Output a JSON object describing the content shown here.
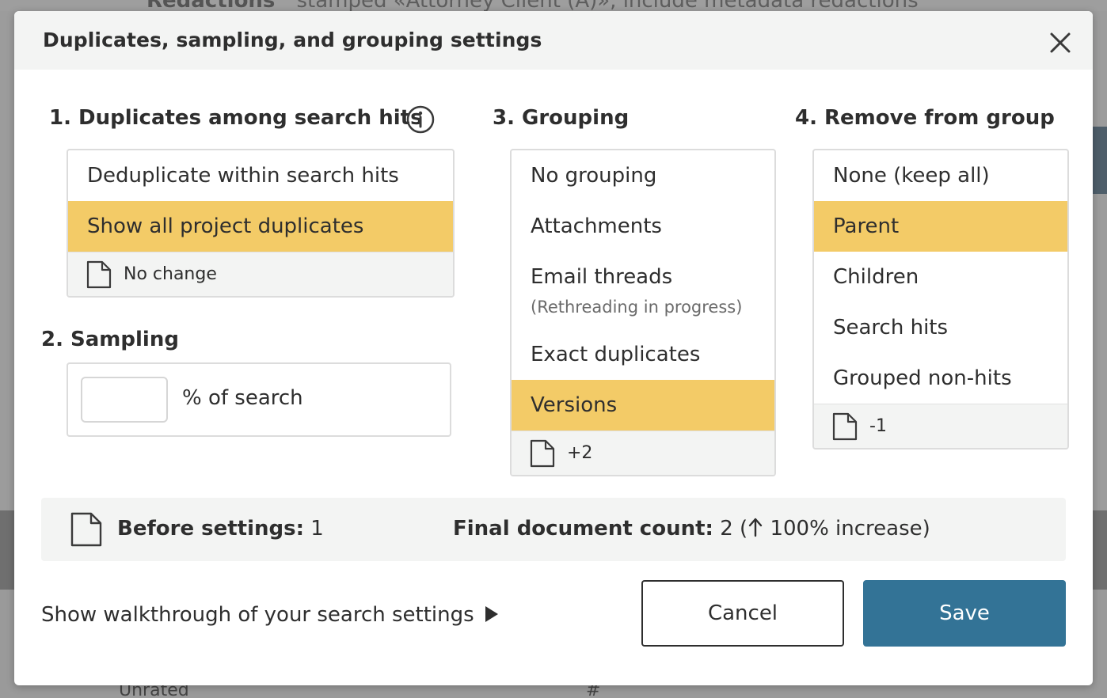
{
  "background": {
    "title": "Redactions",
    "subtitle": "stamped «Attorney Client (A)», include metadata redactions",
    "unrated_label": "Unrated",
    "hash_label": "#"
  },
  "modal": {
    "title": "Duplicates, sampling, and grouping settings",
    "close_icon": "close-icon"
  },
  "section1": {
    "title": "1. Duplicates among search hits",
    "info_icon": "info-icon",
    "options": [
      {
        "label": "Deduplicate within search hits",
        "selected": false
      },
      {
        "label": "Show all project duplicates",
        "selected": true
      }
    ],
    "footer": "No change"
  },
  "section2": {
    "title": "2. Sampling",
    "input_value": "",
    "input_label": "% of search"
  },
  "section3": {
    "title": "3. Grouping",
    "options": [
      {
        "label": "No grouping",
        "selected": false
      },
      {
        "label": "Attachments",
        "selected": false
      },
      {
        "label": "Email threads",
        "note": "(Rethreading in progress)",
        "selected": false
      },
      {
        "label": "Exact duplicates",
        "selected": false
      },
      {
        "label": "Versions",
        "selected": true
      }
    ],
    "footer": "+2"
  },
  "section4": {
    "title": "4. Remove from group",
    "options": [
      {
        "label": "None (keep all)",
        "selected": false
      },
      {
        "label": "Parent",
        "selected": true
      },
      {
        "label": "Children",
        "selected": false
      },
      {
        "label": "Search hits",
        "selected": false
      },
      {
        "label": "Grouped non-hits",
        "selected": false
      }
    ],
    "footer": "-1"
  },
  "summary": {
    "before_label": "Before settings:",
    "before_value": "1",
    "final_label": "Final document count:",
    "final_value": "2",
    "final_change_open": "(",
    "final_change": "100% increase)"
  },
  "footer": {
    "walkthrough": "Show walkthrough of your search settings",
    "cancel": "Cancel",
    "save": "Save"
  },
  "colors": {
    "selected": "#f3cb67",
    "primary": "#337396",
    "panel": "#f3f4f3"
  }
}
